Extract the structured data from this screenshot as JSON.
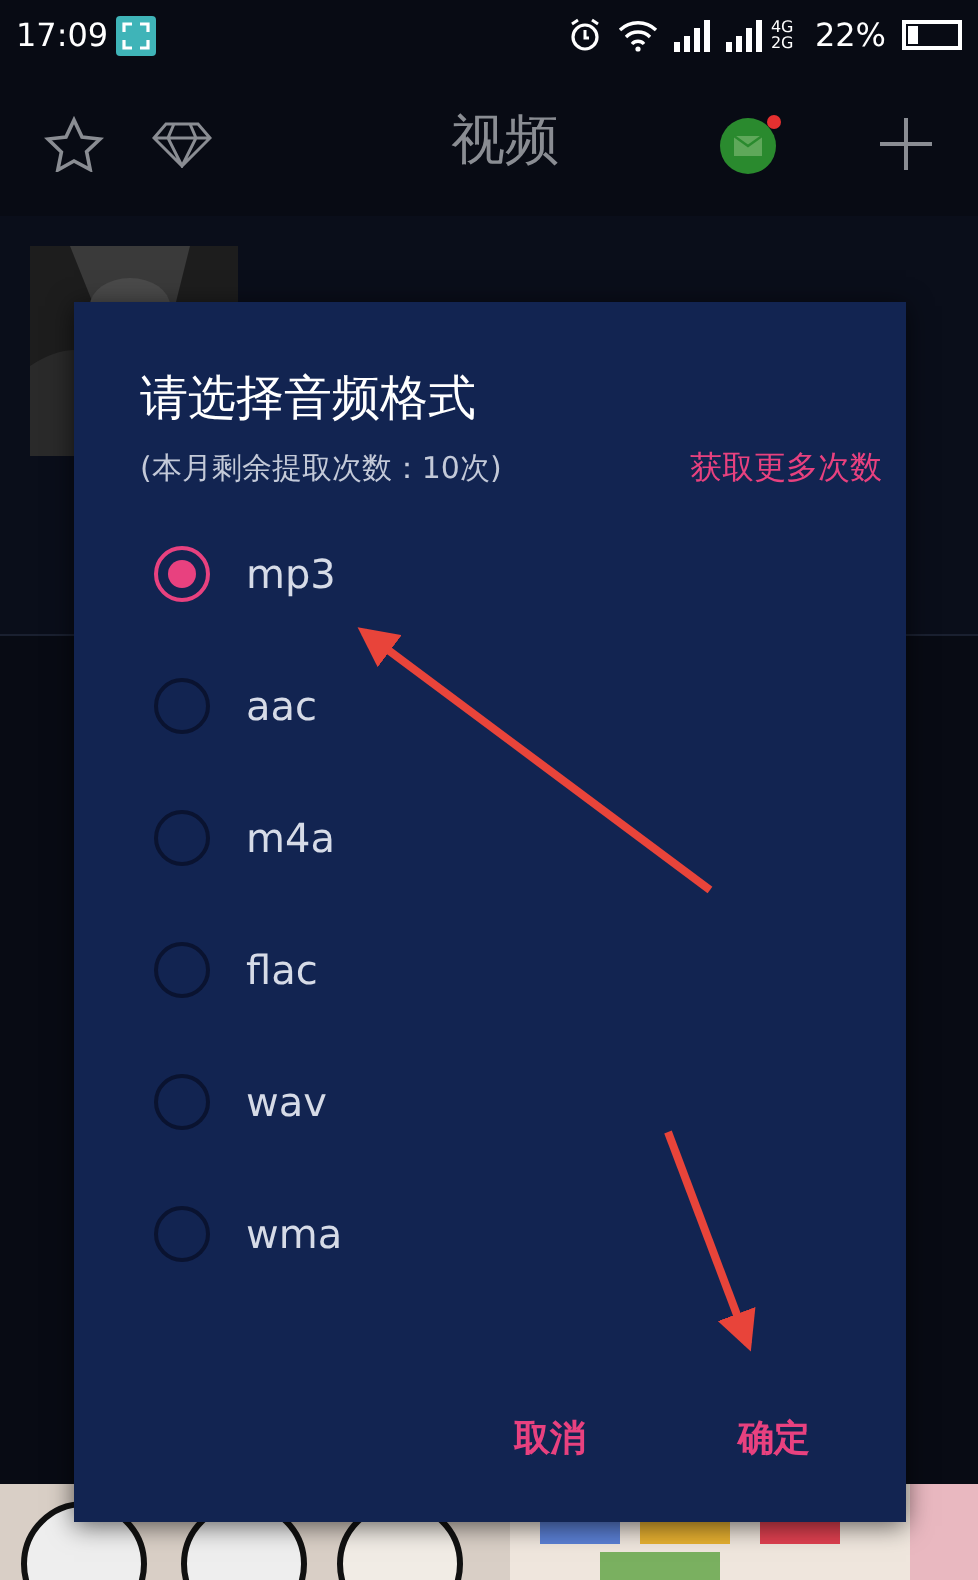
{
  "status_bar": {
    "time": "17:09",
    "network": "4G 2G",
    "battery": "22%"
  },
  "app_bar": {
    "title": "视频",
    "mail_badge": true
  },
  "dialog": {
    "title": "请选择音频格式",
    "quota": "(本月剩余提取次数：10次)",
    "more_link": "获取更多次数",
    "options": [
      {
        "label": "mp3",
        "selected": true
      },
      {
        "label": "aac",
        "selected": false
      },
      {
        "label": "m4a",
        "selected": false
      },
      {
        "label": "flac",
        "selected": false
      },
      {
        "label": "wav",
        "selected": false
      },
      {
        "label": "wma",
        "selected": false
      }
    ],
    "buttons": [
      "取消",
      "确定"
    ]
  }
}
